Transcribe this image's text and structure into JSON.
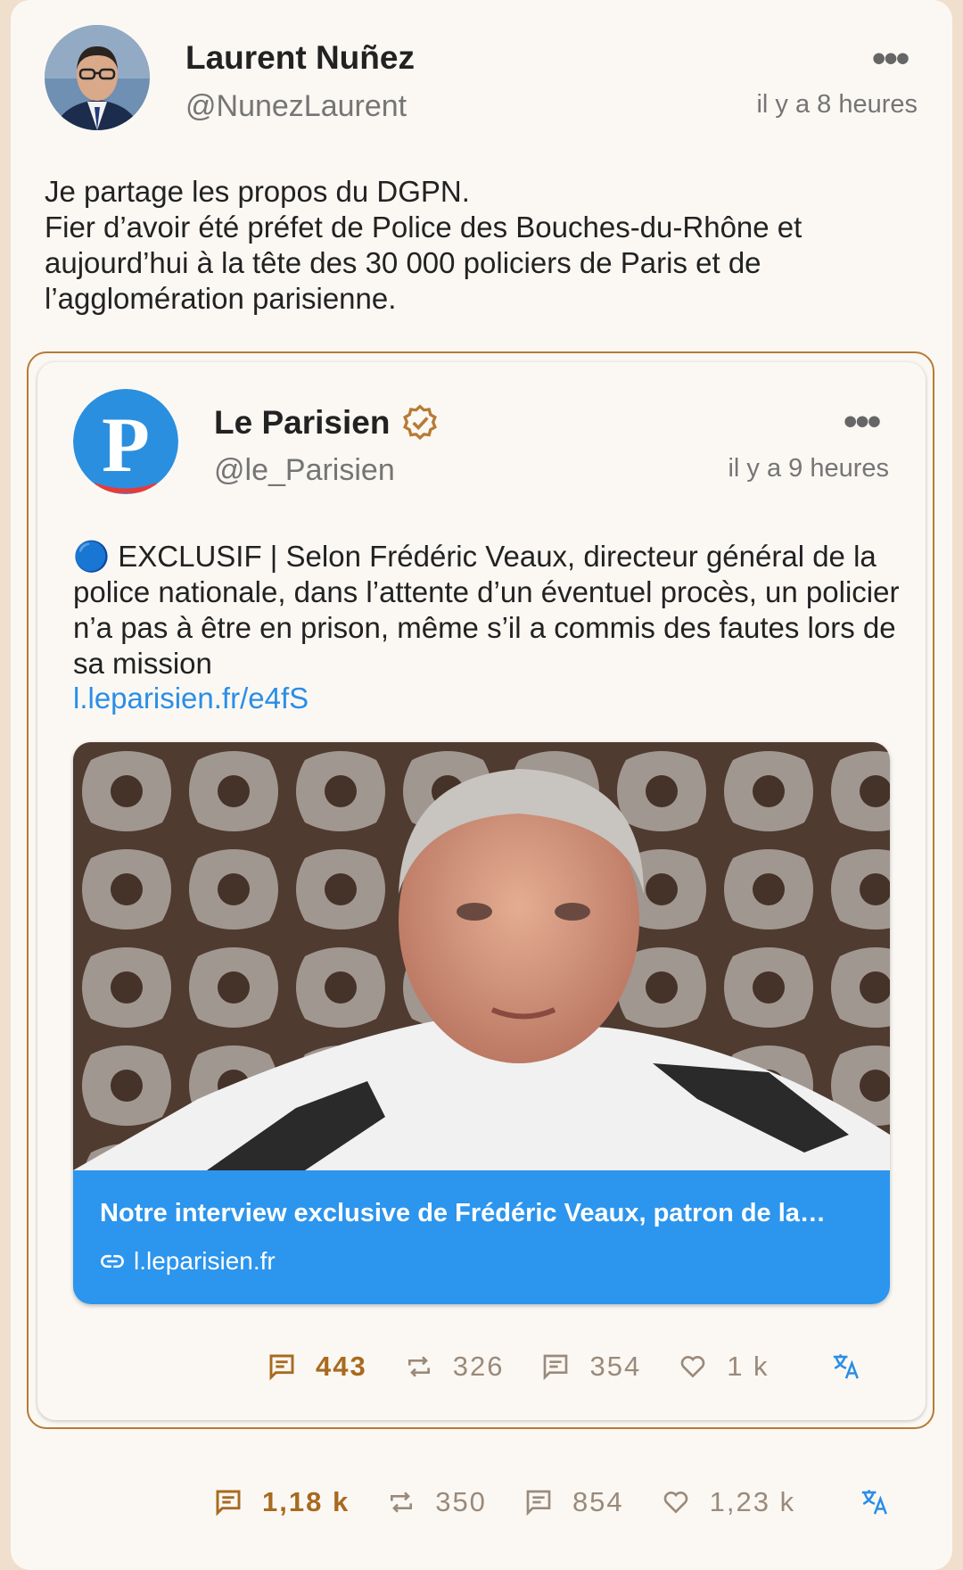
{
  "post": {
    "author": "Laurent Nuñez",
    "handle": "@NunezLaurent",
    "time": "il y a 8 heures",
    "text": "Je partage les propos du DGPN.\nFier d’avoir été préfet de Police des Bouches-du-Rhône et aujourd’hui à la tête des 30 000 policiers de Paris et de l’agglomération parisienne.",
    "stats": {
      "replies": "1,18 k",
      "boosts": "350",
      "quotes": "854",
      "likes": "1,23 k"
    }
  },
  "quoted": {
    "author": "Le Parisien",
    "handle": "@le_Parisien",
    "time": "il y a 9 heures",
    "avatar_letter": "P",
    "text": "🔵 EXCLUSIF | Selon Frédéric Veaux, directeur général de la police nationale, dans l’attente d’un éventuel procès, un policier n’a pas à être en prison, même s’il a commis des fautes lors de sa mission",
    "link": "l.leparisien.fr/e4fS",
    "card": {
      "title": "Notre interview exclusive de Frédéric Veaux, patron de la…",
      "domain": "l.leparisien.fr"
    },
    "stats": {
      "replies": "443",
      "boosts": "326",
      "quotes": "354",
      "likes": "1 k"
    }
  },
  "colors": {
    "accent": "#a86a1f",
    "link": "#2a8ee6",
    "card": "#2c95ed",
    "quote_border": "#b77a35"
  }
}
